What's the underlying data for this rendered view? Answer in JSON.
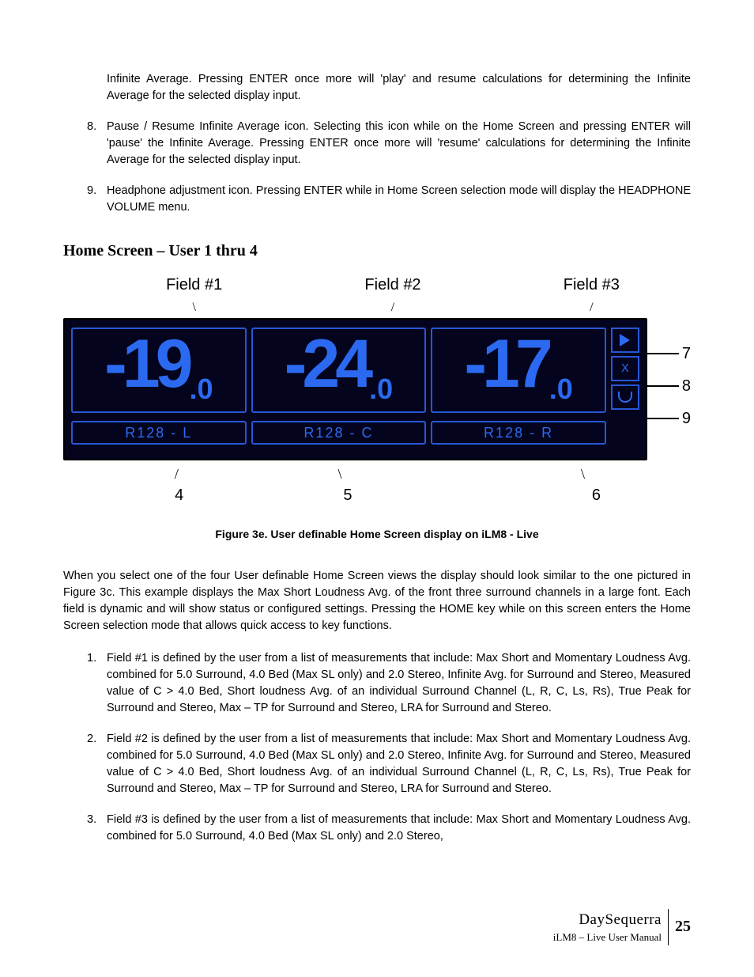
{
  "intro_cont": "Infinite Average.  Pressing ENTER once more will 'play' and resume calculations for determining the Infinite Average for the selected display input.",
  "item8_num": "8.",
  "item8_text": "Pause / Resume Infinite Average icon.  Selecting this icon while on the Home Screen and pressing ENTER will 'pause' the Infinite Average.  Pressing ENTER once more will 'resume' calculations for determining the Infinite Average for the selected display input.",
  "item9_num": "9.",
  "item9_text": "Headphone adjustment icon. Pressing ENTER while in Home Screen selection mode will display the HEADPHONE VOLUME menu.",
  "heading": "Home Screen – User 1 thru 4",
  "top_labels": {
    "f1": "Field #1",
    "f2": "Field #2",
    "f3": "Field #3"
  },
  "readouts": {
    "f1_big": "-19",
    "f1_dec": ".0",
    "f2_big": "-24",
    "f2_dec": ".0",
    "f3_big": "-17",
    "f3_dec": ".0"
  },
  "side_callouts": {
    "c7": "7",
    "c8": "8",
    "c9": "9"
  },
  "side_icon_text": {
    "mid": "X"
  },
  "under_labels": {
    "u4": "R128 - L",
    "u5": "R128 - C",
    "u6": "R128 - R"
  },
  "bottom_nums": {
    "n4": "4",
    "n5": "5",
    "n6": "6"
  },
  "figure_caption": "Figure 3e.   User definable Home Screen display on iLM8 - Live",
  "body_para": "When you select one of the four User definable Home Screen views the display should look similar to the one pictured in Figure 3c. This example displays the Max Short Loudness Avg. of the front three surround channels in a large font.  Each field is dynamic and will show status or configured settings. Pressing the HOME key while on this screen enters the Home Screen selection mode that allows quick access to key functions.",
  "li1_num": "1.",
  "li1_text": "Field #1 is defined by the user from a list of measurements that include: Max Short and Momentary Loudness Avg. combined for 5.0 Surround, 4.0 Bed (Max SL only) and 2.0 Stereo, Infinite Avg. for Surround and Stereo, Measured value of C > 4.0 Bed, Short loudness Avg. of an individual Surround Channel (L, R, C, Ls, Rs), True Peak for Surround and Stereo, Max – TP for Surround and Stereo, LRA for Surround and Stereo.",
  "li2_num": "2.",
  "li2_text": "Field #2 is defined by the user from a list of measurements that include: Max Short and Momentary Loudness Avg. combined for 5.0 Surround, 4.0 Bed (Max SL only) and 2.0 Stereo, Infinite Avg. for Surround and Stereo, Measured value of C > 4.0 Bed, Short loudness Avg. of an individual Surround Channel (L, R, C, Ls, Rs), True Peak for Surround and Stereo, Max – TP for Surround and Stereo, LRA for Surround and Stereo.",
  "li3_num": "3.",
  "li3_text": "Field #3 is defined by the user from a list of measurements that include: Max Short and Momentary Loudness Avg. combined for 5.0 Surround, 4.0 Bed (Max SL only) and 2.0 Stereo,",
  "footer": {
    "brand": "DaySequerra",
    "sub": "iLM8 – Live User Manual",
    "page": "25"
  }
}
